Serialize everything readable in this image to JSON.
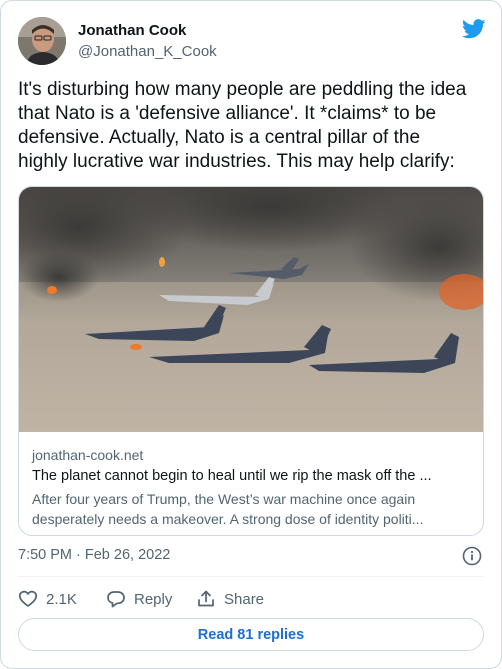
{
  "colors": {
    "brand": "#1d9bf0",
    "link": "#1d6fd1",
    "text": "#0f1419",
    "secondary": "#536471",
    "border": "#cfd9de"
  },
  "author": {
    "name": "Jonathan Cook",
    "handle": "@Jonathan_K_Cook",
    "avatar_icon": "profile-photo"
  },
  "platform_icon": "twitter-bird-icon",
  "tweet": {
    "lines": [
      "It's disturbing how many people are peddling the idea",
      "that Nato is a 'defensive alliance'. It *claims* to be",
      "defensive. Actually, Nato is a central pillar of the",
      "highly lucrative war industries. This may help clarify:"
    ]
  },
  "link_card": {
    "image_icon": "fighter-jets-over-burning-oil-fields-photo",
    "domain": "jonathan-cook.net",
    "title": "The planet cannot begin to heal until we rip the mask off the ...",
    "description_lines": [
      "After four years of Trump, the West’s war machine once again",
      "desperately needs a makeover. A strong dose of identity politi..."
    ]
  },
  "meta": {
    "timestamp": "7:50 PM · Feb 26, 2022",
    "info_icon": "info-icon"
  },
  "actions": {
    "like_count": "2.1K",
    "reply_label": "Reply",
    "share_label": "Share"
  },
  "read_replies_label": "Read 81 replies"
}
